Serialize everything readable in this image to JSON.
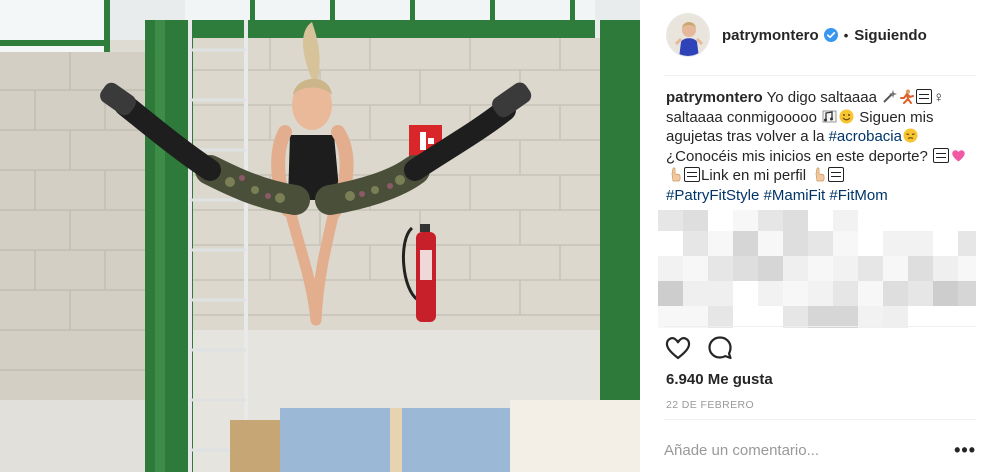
{
  "post": {
    "username": "patrymontero",
    "follow_dot": "•",
    "follow_label": "Siguiendo",
    "caption": {
      "username": "patrymontero",
      "text_1": " Yo digo saltaaaa ",
      "text_2": " saltaaaa conmigooooo ",
      "text_3": " Siguen mis agujetas tras volver a la ",
      "hashtag_1": "#acrobacia",
      "text_4": " ¿Conocéis mis inicios en este deporte? ",
      "text_5": "Link en mi perfil ",
      "hashtag_2": "#PatryFitStyle",
      "hashtag_3": "#MamiFit",
      "hashtag_4": "#FitMom",
      "emoji_female_sign": "♀"
    },
    "likes_label": "6.940 Me gusta",
    "date_label": "22 DE FEBRERO",
    "comment_placeholder": "Añade un comentario...",
    "more_options_label": "•••"
  },
  "icons": {
    "like": "heart-outline-icon",
    "comment": "speech-bubble-icon",
    "verified": "verified-badge-icon",
    "more": "more-options-icon"
  },
  "colors": {
    "text": "#262626",
    "hashtag": "#003569",
    "muted": "#999999",
    "verified": "#3897f0",
    "divider": "#efefef"
  }
}
